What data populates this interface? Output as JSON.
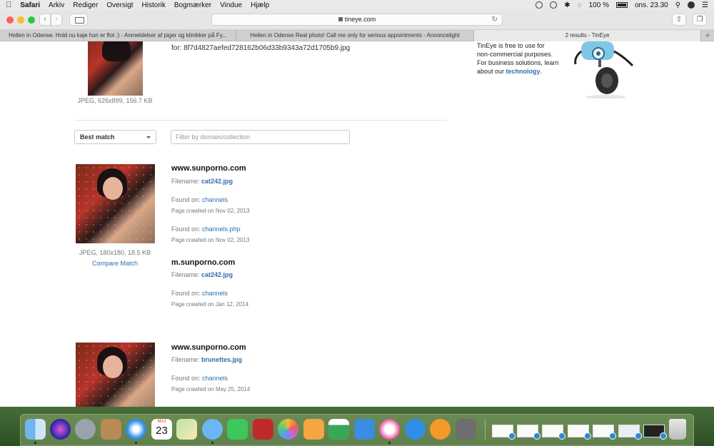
{
  "menubar": {
    "app_name": "Safari",
    "menus": [
      "Arkiv",
      "Rediger",
      "Oversigt",
      "Historik",
      "Bogmærker",
      "Vindue",
      "Hjælp"
    ],
    "battery": "100 %",
    "clock": "ons. 23.30"
  },
  "browser": {
    "url": "tineye.com",
    "tabs": [
      "Hellen in Odense. Hold nu kaje hun er flot :) - Anmeldelser af piger og klinikker på Fy...",
      "Hellen in Odense Real photo! Call me only for serious appointments - Annoncelight",
      "2 results - TinEye"
    ]
  },
  "query": {
    "hash_line": "for: 8f7d4827aefed728162b06d33b9343a72d1705b9.jpg",
    "image_meta": "JPEG, 626x899, 156.7 KB"
  },
  "sidebar": {
    "line1": "TinEye is free to use for",
    "line2": "non-commercial purposes.",
    "line3": "For business solutions, learn",
    "line4_prefix": "about our ",
    "line4_link": "technology",
    "line4_suffix": "."
  },
  "controls": {
    "sort_label": "Best match",
    "filter_placeholder": "Filter by domain/collection"
  },
  "labels": {
    "filename": "Filename: ",
    "found_on": "Found on: "
  },
  "results": [
    {
      "image_meta": "JPEG, 180x180, 18.5 KB",
      "compare": "Compare Match",
      "entries": [
        {
          "domain": "www.sunporno.com",
          "filename": "cat242.jpg",
          "found": [
            {
              "page": "channels",
              "crawled": "Page crawled on Nov 02, 2013"
            },
            {
              "page": "channels.php",
              "crawled": "Page crawled on Nov 02, 2013"
            }
          ]
        },
        {
          "domain": "m.sunporno.com",
          "filename": "cat242.jpg",
          "found": [
            {
              "page": "channels",
              "crawled": "Page crawled on Jan 12, 2014"
            }
          ]
        }
      ]
    },
    {
      "entries": [
        {
          "domain": "www.sunporno.com",
          "filename": "brunettes.jpg",
          "found": [
            {
              "page": "channels",
              "crawled": "Page crawled on May 25, 2014"
            }
          ]
        }
      ]
    }
  ],
  "dock": {
    "calendar_month": "MAJ",
    "calendar_day": "23"
  }
}
